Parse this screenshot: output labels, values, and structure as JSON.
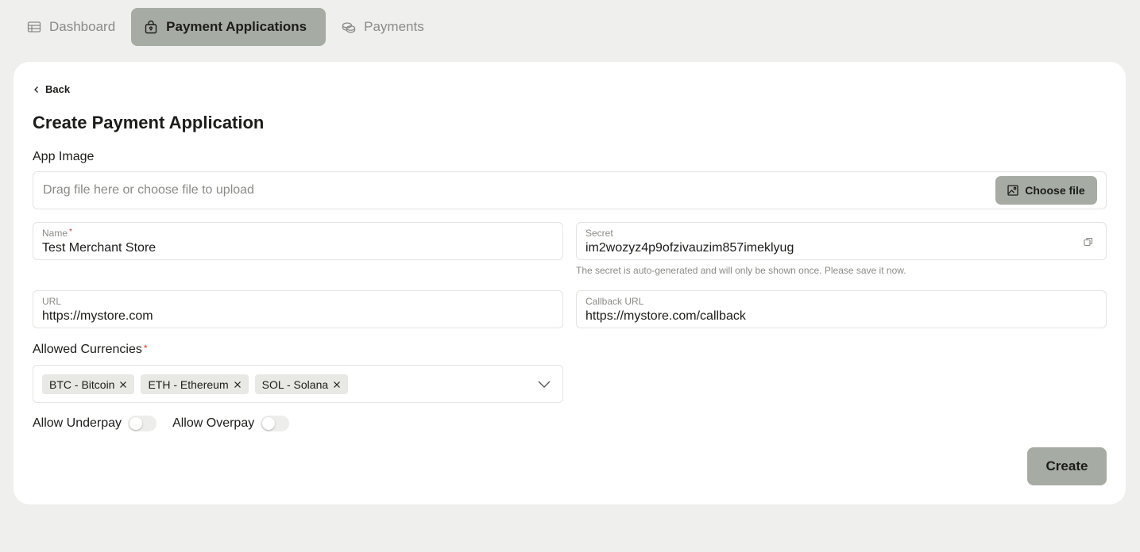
{
  "nav": {
    "tabs": [
      {
        "label": "Dashboard",
        "icon": "table-icon",
        "active": false
      },
      {
        "label": "Payment Applications",
        "icon": "lock-bag-icon",
        "active": true
      },
      {
        "label": "Payments",
        "icon": "coins-icon",
        "active": false
      }
    ]
  },
  "page": {
    "back_label": "Back",
    "title": "Create Payment Application"
  },
  "app_image": {
    "label": "App Image",
    "placeholder": "Drag file here or choose file to upload",
    "choose_label": "Choose file"
  },
  "fields": {
    "name": {
      "label": "Name",
      "required_mark": "*",
      "value": "Test Merchant Store"
    },
    "secret": {
      "label": "Secret",
      "value": "im2wozyz4p9ofzivauzim857imeklyug",
      "hint": "The secret is auto-generated and will only be shown once. Please save it now."
    },
    "url": {
      "label": "URL",
      "value": "https://mystore.com"
    },
    "callback_url": {
      "label": "Callback URL",
      "value": "https://mystore.com/callback"
    }
  },
  "currencies": {
    "label": "Allowed Currencies",
    "required_mark": "*",
    "selected": [
      "BTC - Bitcoin",
      "ETH - Ethereum",
      "SOL - Solana"
    ]
  },
  "toggles": {
    "underpay": {
      "label": "Allow Underpay",
      "on": false
    },
    "overpay": {
      "label": "Allow Overpay",
      "on": false
    }
  },
  "actions": {
    "create_label": "Create"
  },
  "colors": {
    "background": "#efefee",
    "card": "#ffffff",
    "accent": "#a6aca3",
    "required": "#dd3333"
  }
}
